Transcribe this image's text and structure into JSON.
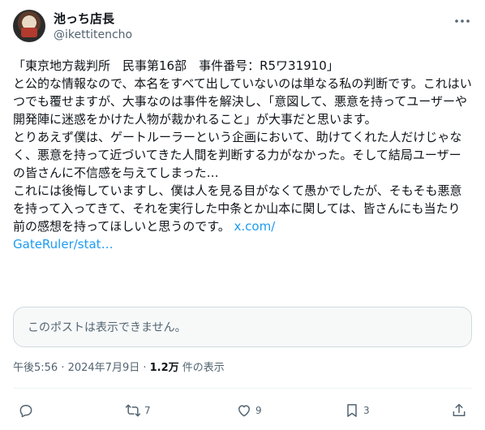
{
  "post": {
    "author_name": "池っち店長",
    "author_handle": "@ikettitencho",
    "body_text": "「東京地方裁判所　民事第16部　事件番号：R5ワ31910」\nと公的な情報なので、本名をすべて出していないのは単なる私の判断です。これはいつでも覆せますが、大事なのは事件を解決し、「意図して、悪意を持ってユーザーや開発陣に迷惑をかけた人物が裁かれること」が大事だと思います。\nとりあえず僕は、ゲートルーラーという企画において、助けてくれた人だけじゃなく、悪意を持って近づいてきた人間を判断する力がなかった。そして結局ユーザーの皆さんに不信感を与えてしまった…\nこれには後悔していますし、僕は人を見る目がなくて愚かでしたが、そもそも悪意を持って入ってきて、それを実行した中条とか山本に関しては、皆さんにも当たり前の感想を持ってほしいと思うのです。 ",
    "link_text": "x.com/\nGateRuler/stat…",
    "quoted_unavailable": "このポストは表示できません。",
    "timestamp": "午後5:56 · 2024年7月9日",
    "separator": " · ",
    "views_count": "1.2万",
    "views_label": " 件の表示"
  },
  "actions": {
    "reply_count": "",
    "repost_count": "7",
    "like_count": "9",
    "bookmark_count": "3"
  },
  "colors": {
    "link": "#1d9bf0",
    "secondary_text": "#536471",
    "border": "#cfd9de"
  }
}
